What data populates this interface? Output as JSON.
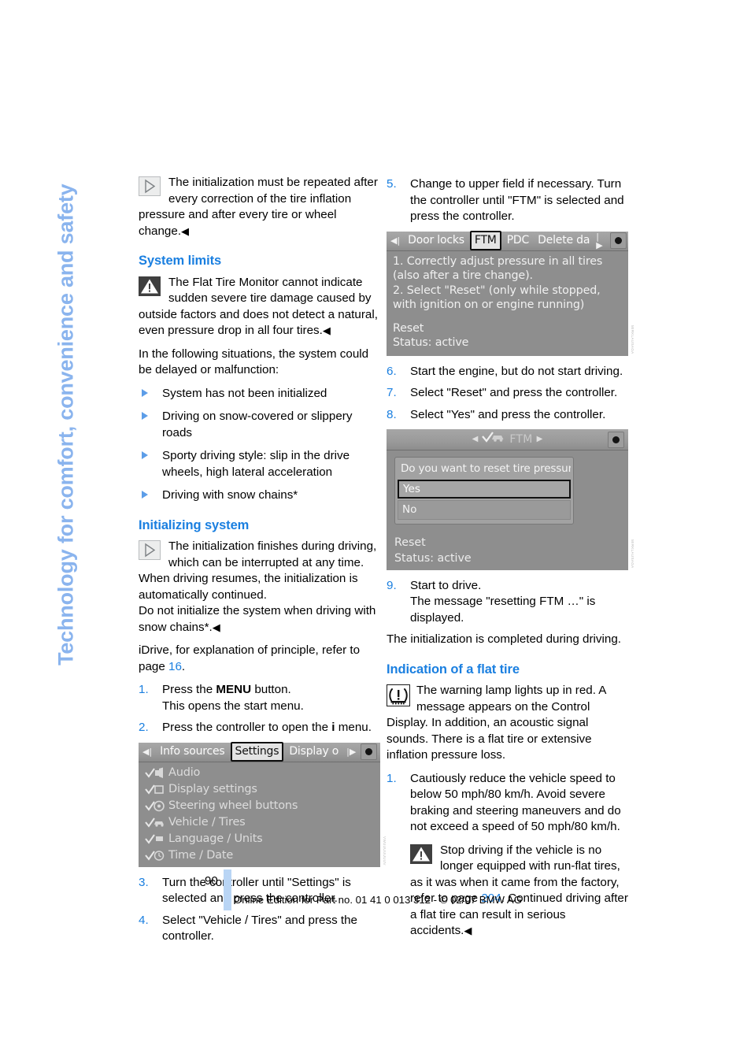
{
  "chapter_tab": "Technology for comfort, convenience and safety",
  "page_number": "90",
  "footer_note": "Online Edition for Part no. 01 41 0 013 312 - © 02/07 BMW AG",
  "left_column": {
    "note_top": "The initialization must be repeated after every correction of the tire inflation pressure and after every tire or wheel change.",
    "system_limits": {
      "heading": "System limits",
      "warning": "The Flat Tire Monitor cannot indicate sudden severe tire damage caused by outside factors and does not detect a natural, even pressure drop in all four tires.",
      "intro": "In the following situations, the system could be delayed or malfunction:",
      "bullets": [
        "System has not been initialized",
        "Driving on snow-covered or slippery roads",
        "Sporty driving style: slip in the drive wheels, high lateral acceleration",
        "Driving with snow chains*"
      ]
    },
    "initializing": {
      "heading": "Initializing system",
      "note_line1": "The initialization finishes during driving, which can be interrupted at any time.",
      "note_line2": "When driving resumes, the initialization is automatically continued.",
      "note_line3": "Do not initialize the system when driving with snow chains*.",
      "idrive_ref_pre": "iDrive, for explanation of principle, refer to page ",
      "idrive_ref_page": "16",
      "idrive_ref_post": ".",
      "steps": [
        {
          "num": "1.",
          "text_pre": "Press the ",
          "text_bold": "MENU",
          "text_post": " button.",
          "text_line2": "This opens the start menu."
        },
        {
          "num": "2.",
          "text_pre": "Press the controller to open the ",
          "text_bold": "i",
          "text_post": " menu."
        }
      ],
      "steps_after": [
        {
          "num": "3.",
          "text": "Turn the controller until \"Settings\" is selected and press the controller."
        },
        {
          "num": "4.",
          "text": "Select \"Vehicle / Tires\" and press the controller."
        }
      ]
    },
    "screenshot_settings": {
      "id_label": "VWUUUUUUUV",
      "tabs": [
        {
          "label": "Info sources",
          "selected": false
        },
        {
          "label": "Settings",
          "selected": true
        },
        {
          "label": "Display o",
          "selected": false
        }
      ],
      "menu_items": [
        {
          "icon": "check-audio-icon",
          "label": "Audio"
        },
        {
          "icon": "check-display-icon",
          "label": "Display settings"
        },
        {
          "icon": "check-steering-wheel-icon",
          "label": "Steering wheel buttons"
        },
        {
          "icon": "check-vehicle-icon",
          "label": "Vehicle / Tires"
        },
        {
          "icon": "check-language-icon",
          "label": "Language / Units"
        },
        {
          "icon": "check-clock-icon",
          "label": "Time / Date"
        }
      ]
    }
  },
  "right_column": {
    "step5": {
      "num": "5.",
      "text": "Change to upper field if necessary. Turn the controller until \"FTM\" is selected and press the controller."
    },
    "screenshot_ftm": {
      "id_label": "MIRKLAUSAGA",
      "tabs": [
        {
          "label": "Door locks",
          "selected": false
        },
        {
          "label": "FTM",
          "selected": true
        },
        {
          "label": "PDC",
          "selected": false
        },
        {
          "label": "Delete da",
          "selected": false
        }
      ],
      "body_lines": [
        "1. Correctly adjust pressure in all tires",
        "(also after a tire change).",
        "2. Select \"Reset\" (only while stopped,",
        "with ignition on or engine running)"
      ],
      "reset_label": "Reset",
      "status_label": "Status: active"
    },
    "steps_678": [
      {
        "num": "6.",
        "text": "Start the engine, but do not start driving."
      },
      {
        "num": "7.",
        "text": "Select \"Reset\" and press the controller."
      },
      {
        "num": "8.",
        "text": "Select \"Yes\" and press the controller."
      }
    ],
    "screenshot_dialog": {
      "id_label": "MIRKLAUSAGA",
      "title": "FTM",
      "question": "Do you want to reset tire pressur",
      "options": [
        {
          "label": "Yes",
          "selected": true
        },
        {
          "label": "No",
          "selected": false
        }
      ],
      "reset_label": "Reset",
      "status_label": "Status:  active"
    },
    "step9": {
      "num": "9.",
      "line1": "Start to drive.",
      "line2": "The message \"resetting FTM …\" is displayed."
    },
    "after_step9": "The initialization is completed during driving.",
    "flat_tire": {
      "heading": "Indication of a flat tire",
      "warning": "The warning lamp lights up in red. A message appears on the Control Display. In addition, an acoustic signal sounds. There is a flat tire or extensive inflation pressure loss.",
      "step1": {
        "num": "1.",
        "text": "Cautiously reduce the vehicle speed to below 50 mph/80 km/h. Avoid severe braking and steering maneuvers and do not exceed a speed of 50 mph/80 km/h."
      },
      "caution_pre": "Stop driving if the vehicle is no longer equipped with run-flat tires, as it was when it came from the factory, refer to page ",
      "caution_page": "204",
      "caution_post": ". Continued driving after a flat tire can result in serious accidents."
    }
  },
  "colors": {
    "accent_blue": "#1a7fe0",
    "tab_blue": "#8ab4ee",
    "screen_grey": "#8e8e8e",
    "footer_bar": "#b9d5f5"
  }
}
